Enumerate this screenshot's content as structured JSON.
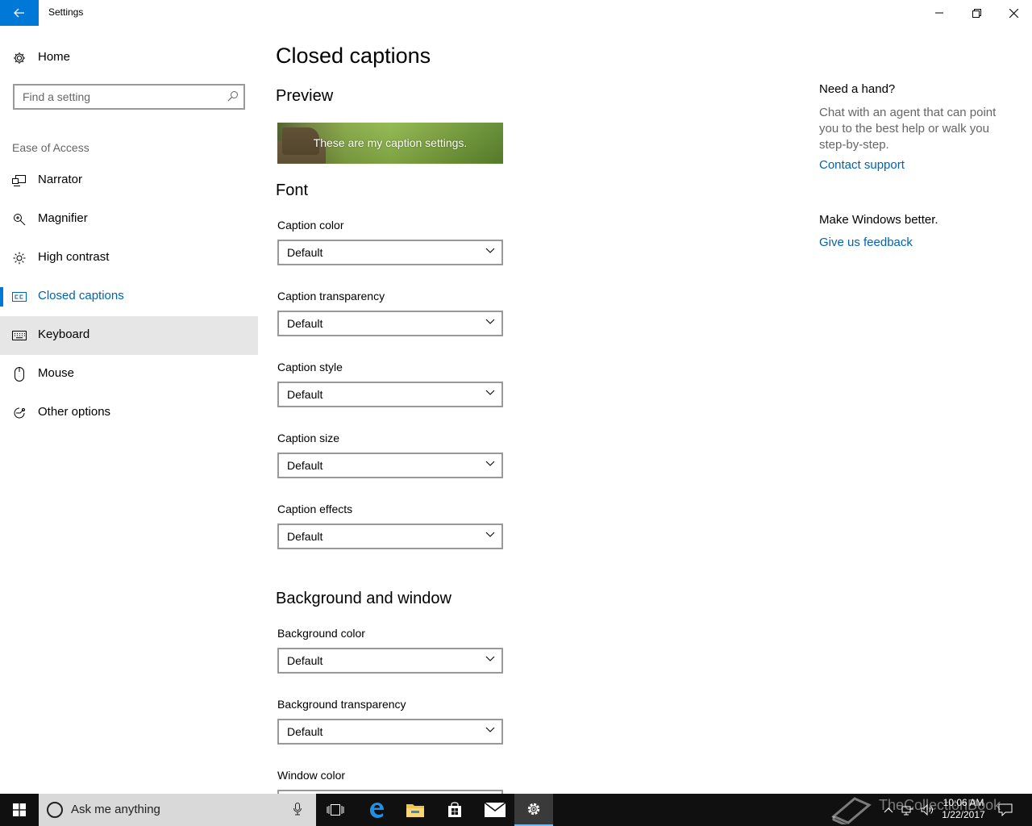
{
  "window": {
    "title": "Settings",
    "back_icon": "arrow-left-icon",
    "accent_color": "#0078d7",
    "link_color": "#0063b1"
  },
  "sidebar": {
    "home_label": "Home",
    "search_placeholder": "Find a setting",
    "section_label": "Ease of Access",
    "items": [
      {
        "label": "Narrator",
        "icon": "narrator-icon"
      },
      {
        "label": "Magnifier",
        "icon": "magnifier-icon"
      },
      {
        "label": "High contrast",
        "icon": "high-contrast-icon"
      },
      {
        "label": "Closed captions",
        "icon": "closed-captions-icon",
        "selected": true
      },
      {
        "label": "Keyboard",
        "icon": "keyboard-icon",
        "hovered": true
      },
      {
        "label": "Mouse",
        "icon": "mouse-icon"
      },
      {
        "label": "Other options",
        "icon": "other-options-icon"
      }
    ]
  },
  "main": {
    "title": "Closed captions",
    "preview_heading": "Preview",
    "preview_text": "These are my caption settings.",
    "font_heading": "Font",
    "font_fields": [
      {
        "label": "Caption color",
        "value": "Default"
      },
      {
        "label": "Caption transparency",
        "value": "Default"
      },
      {
        "label": "Caption style",
        "value": "Default"
      },
      {
        "label": "Caption size",
        "value": "Default"
      },
      {
        "label": "Caption effects",
        "value": "Default"
      }
    ],
    "background_heading": "Background and window",
    "background_fields": [
      {
        "label": "Background color",
        "value": "Default"
      },
      {
        "label": "Background transparency",
        "value": "Default"
      },
      {
        "label": "Window color",
        "value": ""
      }
    ]
  },
  "help_panel": {
    "heading": "Need a hand?",
    "text": "Chat with an agent that can point you to the best help or walk you step-by-step.",
    "support_link": "Contact support",
    "feedback_heading": "Make Windows better.",
    "feedback_link": "Give us feedback"
  },
  "taskbar": {
    "search_text": "Ask me anything",
    "time": "10:06 AM",
    "date": "1/22/2017",
    "watermark": "TheCollectionBook",
    "apps": [
      "task-view-icon",
      "edge-icon",
      "file-explorer-icon",
      "store-icon",
      "mail-icon",
      "settings-icon"
    ]
  }
}
